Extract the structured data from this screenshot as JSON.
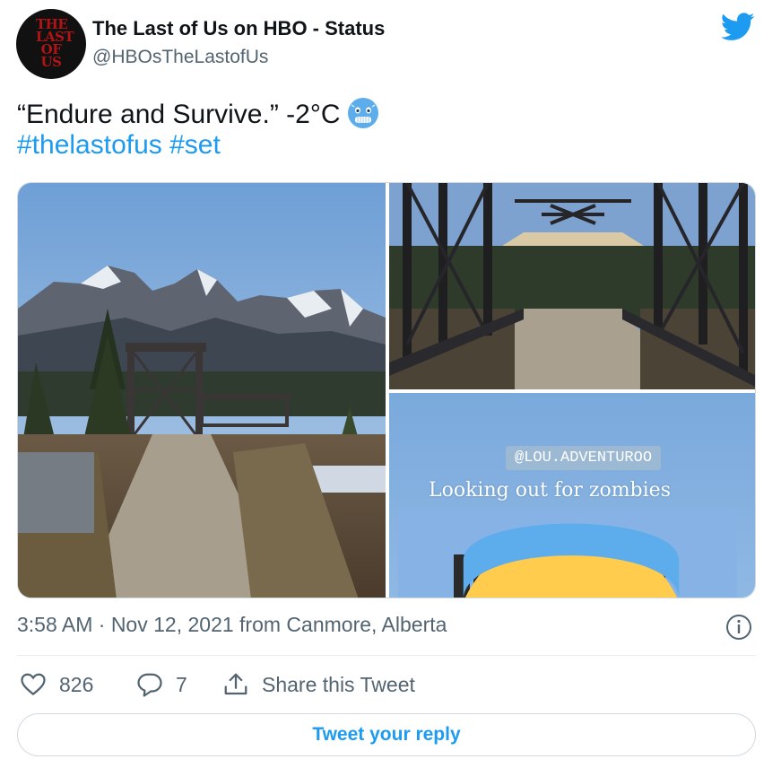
{
  "author": {
    "display_name": "The Last of Us on HBO - Status",
    "handle": "@HBOsTheLastofUs",
    "avatar_logo_lines": [
      "THE",
      "LAST",
      "OF US"
    ]
  },
  "tweet": {
    "text": "“Endure and Survive.” -2°C",
    "hashtags": [
      "#thelastofus",
      "#set"
    ]
  },
  "media": {
    "overlay_tag": "@LOU.ADVENTUROO",
    "overlay_caption": "Looking out for zombies"
  },
  "meta": {
    "timestamp": "3:58 AM · Nov 12, 2021 from Canmore, Alberta"
  },
  "actions": {
    "likes": "826",
    "replies": "7",
    "share_label": "Share this Tweet"
  },
  "reply_button_label": "Tweet your reply",
  "colors": {
    "link": "#1d9bf0",
    "secondary_text": "#536471",
    "border": "#cfd9de"
  },
  "icons": {
    "brand": "twitter-bird-icon",
    "like": "heart-icon",
    "reply": "speech-bubble-icon",
    "share": "share-icon",
    "info": "info-icon"
  }
}
